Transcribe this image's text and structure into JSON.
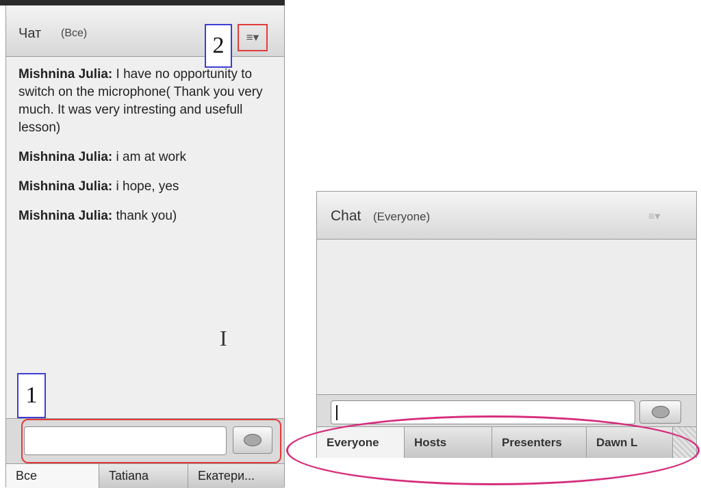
{
  "left_panel": {
    "title": "Чат",
    "subtitle": "(Все)",
    "menu_icon": "≡▾",
    "callouts": [
      "1",
      "2"
    ],
    "messages": [
      {
        "sender": "Mishnina Julia:",
        "text": "I have no opportunity to switch on the microphone( Thank you very much. It was very intresting and usefull lesson)"
      },
      {
        "sender": "Mishnina Julia:",
        "text": "i am at work"
      },
      {
        "sender": "Mishnina Julia:",
        "text": "i hope, yes"
      },
      {
        "sender": "Mishnina Julia:",
        "text": "thank you)"
      }
    ],
    "cursor_glyph": "I",
    "input_value": "",
    "tabs": [
      {
        "label": "Все",
        "active": true
      },
      {
        "label": "Tatiana",
        "active": false
      },
      {
        "label": "Екатери...",
        "active": false
      }
    ]
  },
  "right_panel": {
    "title": "Chat",
    "subtitle": "(Everyone)",
    "menu_icon": "≡▾",
    "input_value": "",
    "tabs": [
      {
        "label": "Everyone",
        "active": true
      },
      {
        "label": "Hosts",
        "active": false
      },
      {
        "label": "Presenters",
        "active": false
      },
      {
        "label": "Dawn  L",
        "active": false
      }
    ],
    "highlight_color": "#d62d7d"
  },
  "colors": {
    "callout_red": "#e23a3a",
    "callout_blue": "#3d3dd6"
  }
}
